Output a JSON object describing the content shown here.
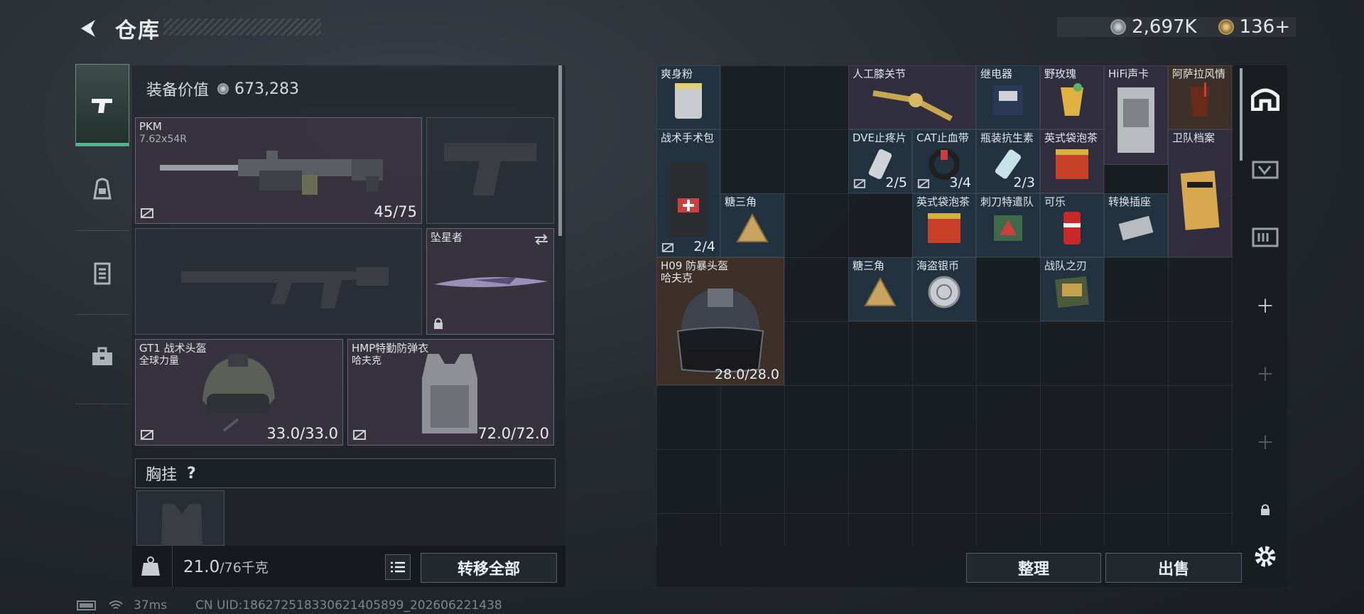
{
  "header": {
    "title": "仓库",
    "silver": "2,697K",
    "gold": "136+"
  },
  "equip": {
    "value_label": "装备价值",
    "value": "673,283"
  },
  "primary": {
    "name": "PKM",
    "ammo": "7.62x54R",
    "count": "45/75"
  },
  "melee": {
    "name": "坠星者"
  },
  "helmet": {
    "name": "GT1 战术头盔",
    "brand": "全球力量",
    "durability": "33.0/33.0"
  },
  "armor": {
    "name": "HMP特勤防弹衣",
    "brand": "哈夫克",
    "durability": "72.0/72.0"
  },
  "chest_rig": {
    "label": "胸挂",
    "help": "?"
  },
  "weight": {
    "value": "21.0",
    "unit": "/76千克"
  },
  "buttons": {
    "transfer_all": "转移全部",
    "organize": "整理",
    "sell": "出售"
  },
  "items": [
    {
      "name": "爽身粉",
      "bg": "blue"
    },
    {
      "name": "人工膝关节",
      "bg": "purple"
    },
    {
      "name": "继电器",
      "bg": "blue"
    },
    {
      "name": "野玫瑰",
      "bg": "purple"
    },
    {
      "name": "HiFi声卡",
      "bg": "purple"
    },
    {
      "name": "阿萨拉风情",
      "bg": "brown"
    },
    {
      "name": "战术手术包",
      "count": "2/4",
      "bg": "blue"
    },
    {
      "name": "DVE止疼片",
      "count": "2/5",
      "bg": "blue"
    },
    {
      "name": "CAT止血带",
      "count": "3/4",
      "bg": "blue"
    },
    {
      "name": "瓶装抗生素",
      "count": "2/3",
      "bg": "blue"
    },
    {
      "name": "英式袋泡茶",
      "bg": "purple"
    },
    {
      "name": "卫队档案",
      "bg": "purple"
    },
    {
      "name": "糖三角",
      "bg": "blue"
    },
    {
      "name": "英式袋泡茶",
      "bg": "blue"
    },
    {
      "name": "刺刀特遣队",
      "bg": "blue"
    },
    {
      "name": "可乐",
      "bg": "blue"
    },
    {
      "name": "转换插座",
      "bg": "blue"
    },
    {
      "name": "H09 防暴头盔",
      "brand": "哈夫克",
      "durability": "28.0/28.0",
      "bg": "brown"
    },
    {
      "name": "糖三角",
      "bg": "blue"
    },
    {
      "name": "海盗银币",
      "bg": "blue"
    },
    {
      "name": "战队之刃",
      "bg": "blue"
    }
  ],
  "status": {
    "ping": "37ms",
    "uid": "CN UID:186272518330621405899_202606221438"
  }
}
